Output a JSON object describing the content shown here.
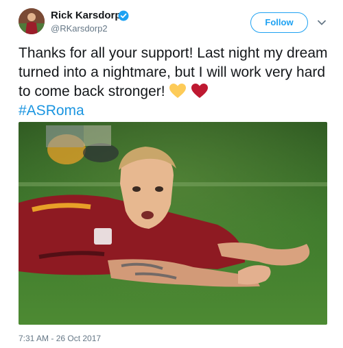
{
  "author": {
    "name": "Rick Karsdorp",
    "handle": "@RKarsdorp2",
    "verified": true
  },
  "follow_label": "Follow",
  "tweet": {
    "text": "Thanks for all your support! Last night my dream turned into a nightmare, but I will work very hard to come back stronger! ",
    "emojis": [
      "yellow-heart",
      "red-heart"
    ],
    "hashtag": "#ASRoma"
  },
  "media": {
    "alt": "Footballer in red kit lying on the pitch with arms spread"
  },
  "timestamp": "7:31 AM - 26 Oct 2017",
  "colors": {
    "link_blue": "#1da1f2",
    "hashtag_blue": "#1b95e0",
    "muted": "#657786"
  }
}
